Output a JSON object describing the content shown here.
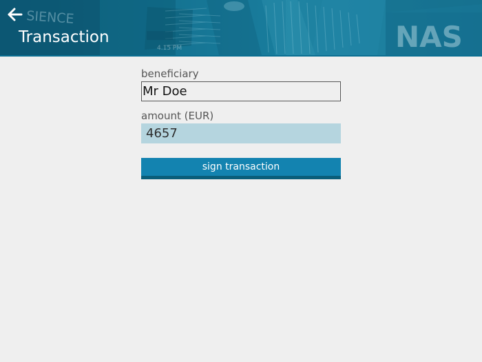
{
  "header": {
    "title": "Transaction",
    "back_icon": "arrow-left-icon",
    "background_image": "stock-market-building-banner",
    "background_text_left": "SIENCE",
    "background_text_right": "NAS",
    "background_small_text_1": "4.15 PM",
    "background_small_text_2": "",
    "colors": {
      "bar": "#136f8d",
      "bar_dark": "#0b6f92",
      "title": "#ffffff"
    }
  },
  "form": {
    "beneficiary_label": "beneficiary",
    "beneficiary_value": "Mr Doe",
    "amount_label": "amount (EUR)",
    "amount_value": "4657",
    "sign_button_label": "sign transaction",
    "colors": {
      "page_background": "#efefef",
      "amount_background": "#b5d5df",
      "button": "#1383b0",
      "button_shadow": "#0a5e7a"
    }
  }
}
